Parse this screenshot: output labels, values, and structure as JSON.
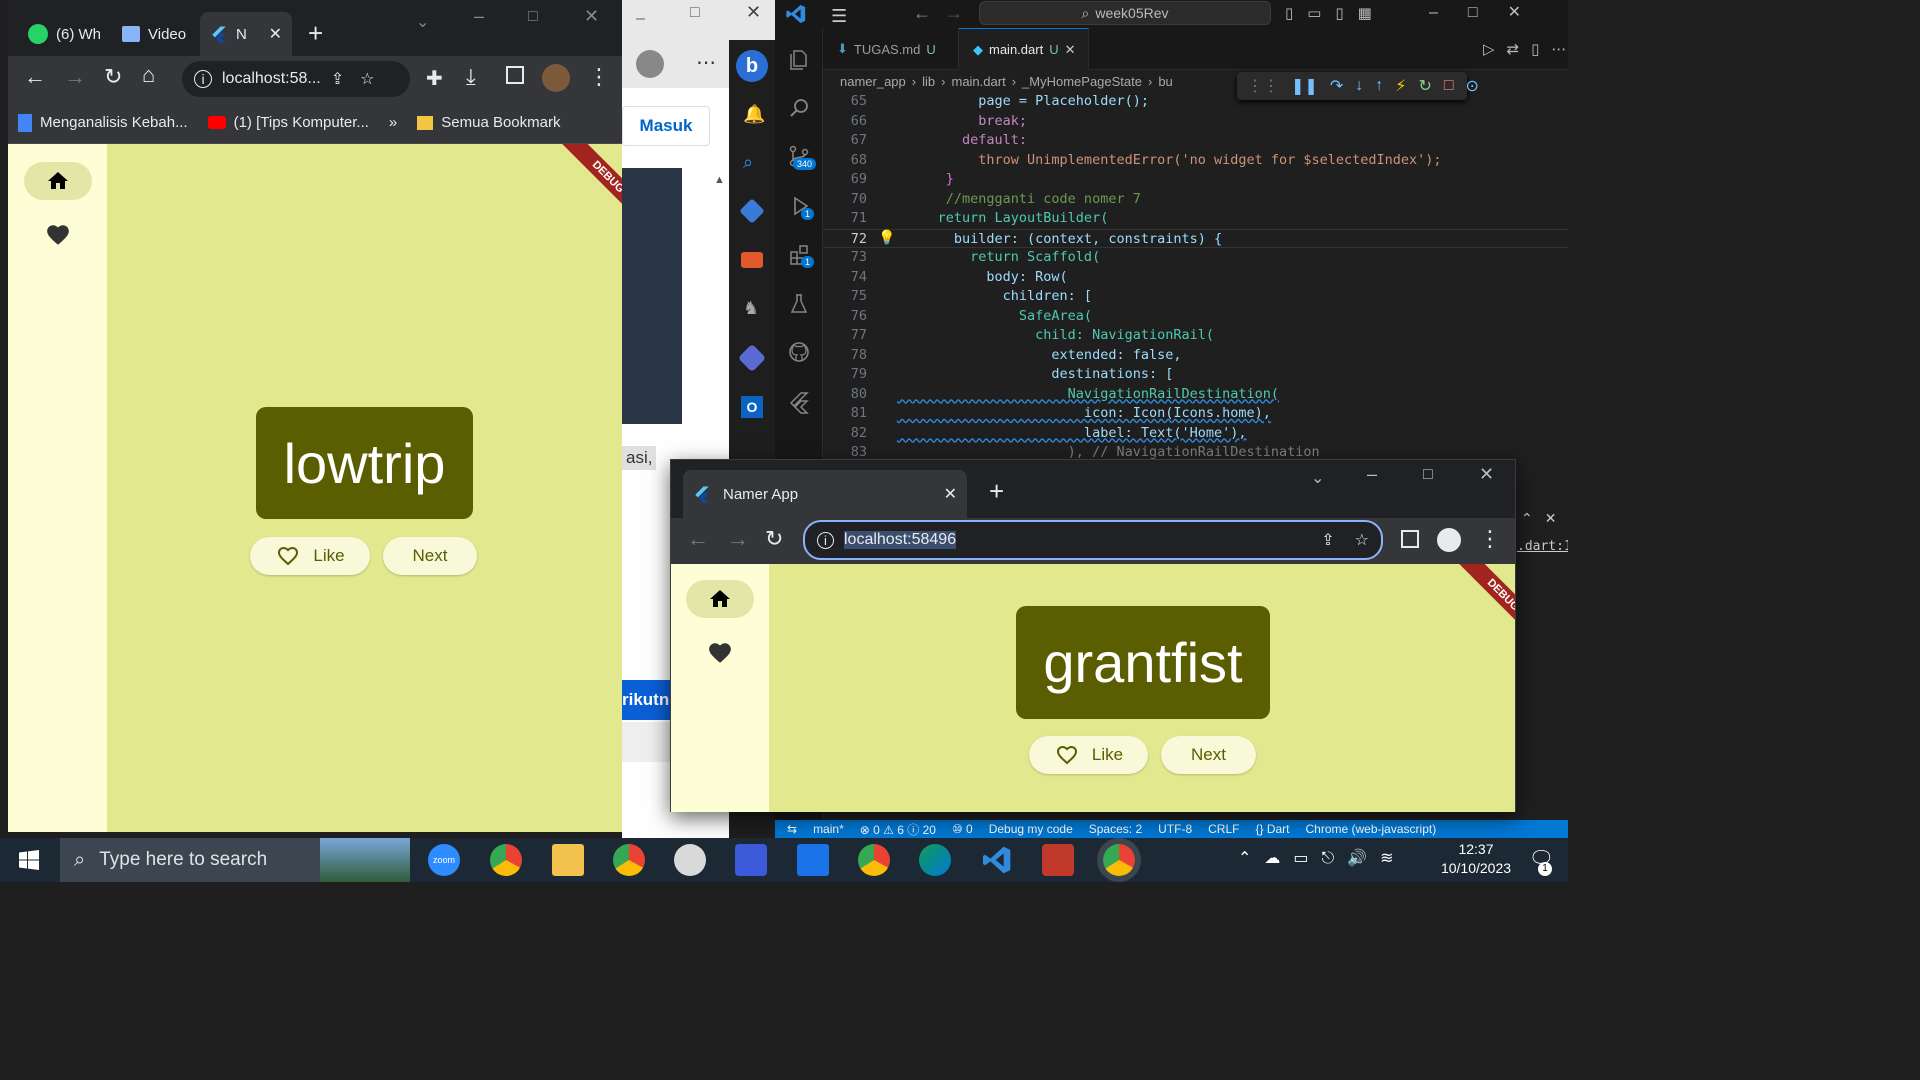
{
  "vscode": {
    "search": "week05Rev",
    "tabs": [
      {
        "name": "TUGAS.md",
        "mod": "U"
      },
      {
        "name": "main.dart",
        "mod": "U"
      }
    ],
    "breadcrumb": [
      "namer_app",
      "lib",
      "main.dart",
      "_MyHomePageState",
      "bu"
    ],
    "badges": {
      "source_control": "340",
      "debug": "1",
      "extensions": "1"
    },
    "code": [
      {
        "n": "65",
        "t": "          page = Placeholder();"
      },
      {
        "n": "66",
        "t": "          break;"
      },
      {
        "n": "67",
        "t": "        default:"
      },
      {
        "n": "68",
        "t": "          throw UnimplementedError('no widget for $selectedIndex');"
      },
      {
        "n": "69",
        "t": "      }"
      },
      {
        "n": "70",
        "t": "      //mengganti code nomer 7"
      },
      {
        "n": "71",
        "t": "     return LayoutBuilder("
      },
      {
        "n": "72",
        "t": "       builder: (context, constraints) {"
      },
      {
        "n": "73",
        "t": "         return Scaffold("
      },
      {
        "n": "74",
        "t": "           body: Row("
      },
      {
        "n": "75",
        "t": "             children: ["
      },
      {
        "n": "76",
        "t": "               SafeArea("
      },
      {
        "n": "77",
        "t": "                 child: NavigationRail("
      },
      {
        "n": "78",
        "t": "                   extended: false,"
      },
      {
        "n": "79",
        "t": "                   destinations: ["
      },
      {
        "n": "80",
        "t": "                     NavigationRailDestination("
      },
      {
        "n": "81",
        "t": "                       icon: Icon(Icons.home),"
      },
      {
        "n": "82",
        "t": "                       label: Text('Home'),"
      },
      {
        "n": "83",
        "t": "                     ), // NavigationRailDestination"
      }
    ],
    "right_peek": ".dart:1",
    "status": [
      "main*",
      "⊗ 0 ⚠ 6 ⓘ 20",
      "⑩ 0",
      "Debug my code",
      "Spaces: 2",
      "UTF-8",
      "CRLF",
      "{} Dart",
      "Chrome (web-javascript)"
    ]
  },
  "edge": {
    "masuk": "Masuk",
    "snippet": "asi,",
    "blue_text": "rikutn"
  },
  "chrome_left": {
    "tabs": [
      {
        "label": "(6) Wh"
      },
      {
        "label": "Video"
      },
      {
        "label": "N"
      }
    ],
    "url": "localhost:58...",
    "bookmarks": [
      "Menganalisis Kebah...",
      "(1) [Tips Komputer...",
      "»",
      "Semua Bookmark"
    ],
    "word": "lowtrip",
    "like": "Like",
    "next": "Next",
    "debug": "DEBUG"
  },
  "chrome_right": {
    "tab": "Namer App",
    "url": "localhost:58496",
    "word": "grantfist",
    "like": "Like",
    "next": "Next",
    "debug": "DEBUG"
  },
  "taskbar": {
    "search_placeholder": "Type here to search",
    "time": "12:37",
    "date": "10/10/2023",
    "notifications": "1"
  },
  "colors": {
    "flutter_bg": "#e1e88e",
    "rail_bg": "#fdfdd6",
    "card": "#5a5d00",
    "vscode_blue": "#0078d4"
  }
}
